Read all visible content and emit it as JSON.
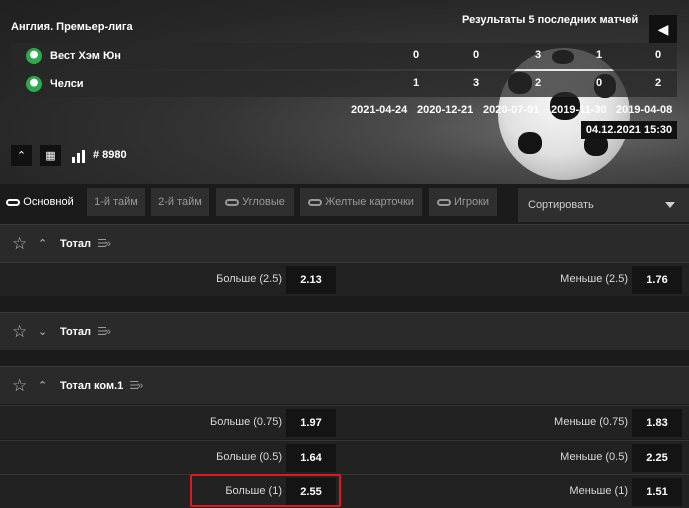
{
  "header": {
    "league": "Англия. Премьер-лига",
    "results_title": "Результаты 5 последних матчей",
    "back_icon": "arrow-left-icon",
    "teams": [
      {
        "name": "Вест Хэм Юн",
        "scores": [
          "0",
          "0",
          "3",
          "1",
          "0"
        ]
      },
      {
        "name": "Челси",
        "scores": [
          "1",
          "3",
          "2",
          "0",
          "2"
        ]
      }
    ],
    "dates": [
      "2021-04-24",
      "2020-12-21",
      "2020-07-01",
      "2019-11-30",
      "2019-04-08"
    ],
    "match_datetime": "04.12.2021  15:30",
    "match_id": "# 8980"
  },
  "tabs": [
    {
      "label": "Основной",
      "active": true,
      "has_link_icon": true
    },
    {
      "label": "1-й тайм",
      "active": false,
      "has_link_icon": false
    },
    {
      "label": "2-й тайм",
      "active": false,
      "has_link_icon": false
    },
    {
      "label": "Угловые",
      "active": false,
      "has_link_icon": true
    },
    {
      "label": "Желтые карточки",
      "active": false,
      "has_link_icon": true
    },
    {
      "label": "Игроки",
      "active": false,
      "has_link_icon": true
    }
  ],
  "sort": {
    "label": "Сортировать"
  },
  "markets": [
    {
      "title": "Тотал",
      "expanded": true,
      "rows": [
        {
          "left_label": "Больше (2.5)",
          "left_odd": "2.13",
          "right_label": "Меньше (2.5)",
          "right_odd": "1.76"
        }
      ]
    },
    {
      "title": "Тотал",
      "expanded": false,
      "rows": []
    },
    {
      "title": "Тотал ком.1",
      "expanded": true,
      "rows": [
        {
          "left_label": "Больше (0.75)",
          "left_odd": "1.97",
          "right_label": "Меньше (0.75)",
          "right_odd": "1.83"
        },
        {
          "left_label": "Больше (0.5)",
          "left_odd": "1.64",
          "right_label": "Меньше (0.5)",
          "right_odd": "2.25"
        },
        {
          "left_label": "Больше (1)",
          "left_odd": "2.55",
          "right_label": "Меньше (1)",
          "right_odd": "1.51"
        }
      ]
    }
  ],
  "colors": {
    "highlight": "#e0181e",
    "background": "#1b1b1b",
    "odd_box": "#141414"
  }
}
